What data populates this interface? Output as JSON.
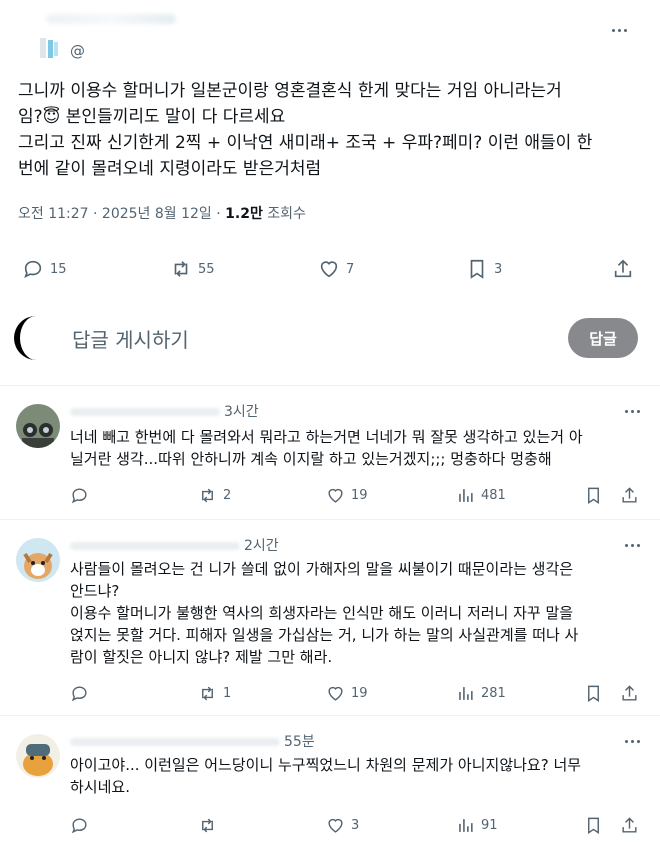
{
  "post": {
    "handle": "@",
    "text": "그니까 이용수 할머니가 일본군이랑 영혼결혼식 한게 맞다는 거임 아니라는거\n임?😇 본인들끼리도 말이 다 다르세요\n그리고 진짜 신기한게 2찍 + 이낙연 새미래+ 조국 + 우파?페미? 이런 애들이 한\n번에 같이 몰려오네 지령이라도 받은거처럼",
    "time": "오전 11:27 · 2025년 8월 12일 · ",
    "views": "1.2만",
    "views_label": " 조회수",
    "stats": {
      "replies": "15",
      "reposts": "55",
      "likes": "7",
      "bookmarks": "3"
    }
  },
  "compose": {
    "placeholder": "답글 게시하기",
    "button": "답글"
  },
  "replies": [
    {
      "handle_partial": "@",
      "time": "3시간",
      "text": "너네 빼고 한번에 다 몰려와서 뭐라고 하는거면 너네가 뭐 잘못 생각하고 있는거 아\n닐거란 생각...따위 안하니까 계속 이지랄 하고 있는거겠지;;; 멍충하다 멍충해",
      "replies": "",
      "reposts": "2",
      "likes": "19",
      "views": "481"
    },
    {
      "handle_partial": "",
      "time": "2시간",
      "text": "사람들이 몰려오는 건 니가 쓸데 없이 가해자의 말을 씨불이기 때문이라는 생각은\n안드냐?\n이용수 할머니가 불행한 역사의 희생자라는 인식만 해도 이러니 저러니 자꾸 말을\n얹지는 못할 거다. 피해자 일생을 가십삼는 거, 니가 하는 말의 사실관계를 떠나 사\n람이 할짓은 아니지 않냐? 제발 그만 해라.",
      "replies": "",
      "reposts": "1",
      "likes": "19",
      "views": "281"
    },
    {
      "handle_partial": "@",
      "time": "55분",
      "text": "아이고야... 이런일은 어느당이니 누구찍었느니 차원의 문제가 아니지않나요? 너무\n하시네요.",
      "replies": "",
      "reposts": "",
      "likes": "3",
      "views": "91"
    }
  ],
  "colors": {
    "text": "#0f1419",
    "muted": "#536471",
    "divider": "#eff3f4",
    "button": "#87898c"
  }
}
